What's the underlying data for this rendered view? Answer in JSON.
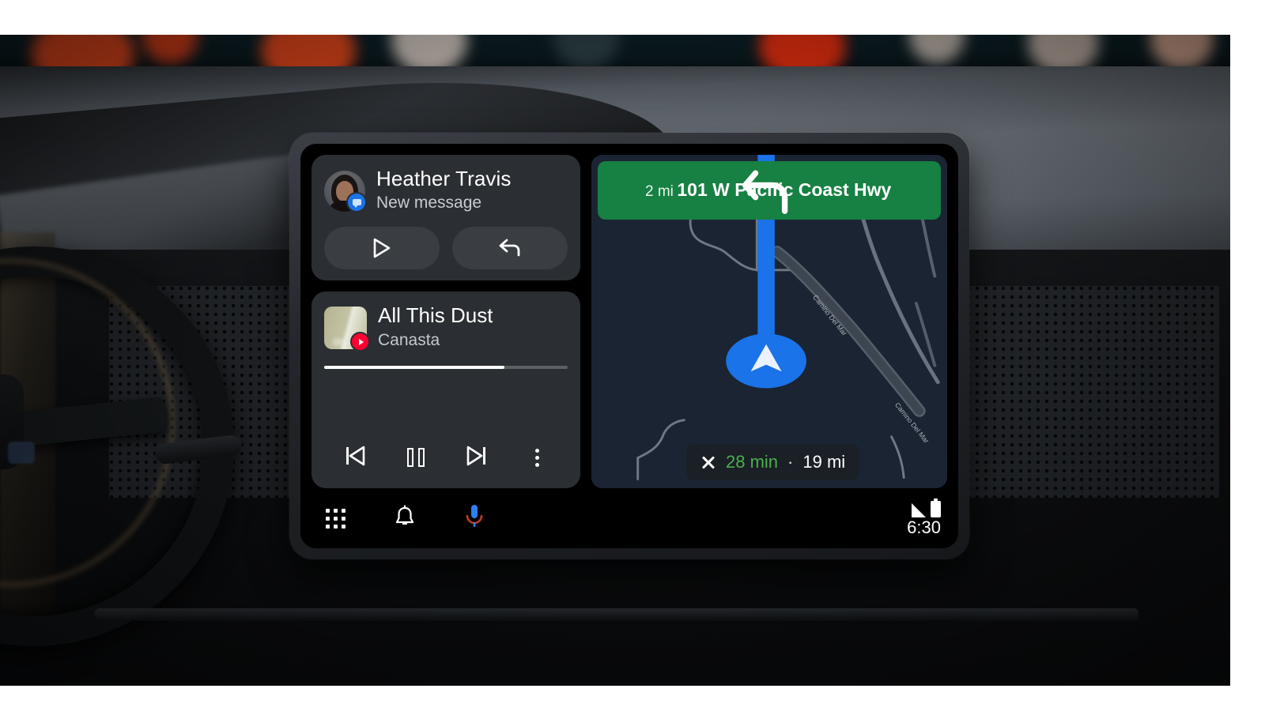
{
  "scene": {
    "description": "car-dashboard-with-head-unit",
    "bokeh_color": "#e8401a",
    "dash_color": "#6b7279"
  },
  "device": {
    "screen_bg": "#000000",
    "card_bg": "#2b2e32"
  },
  "message_card": {
    "name": "Heather Travis",
    "status": "New message",
    "avatar_name": "contact-avatar",
    "badge_app": "messages-badge",
    "actions": [
      {
        "id": "play",
        "icon": "play-icon",
        "label": "Play message"
      },
      {
        "id": "reply",
        "icon": "reply-arrow-icon",
        "label": "Reply"
      }
    ]
  },
  "media_card": {
    "title": "All This Dust",
    "artist": "Canasta",
    "album_badge": "youtube-music-badge",
    "progress_percent": 74,
    "controls": [
      {
        "id": "prev",
        "icon": "skip-previous-icon",
        "label": "Previous"
      },
      {
        "id": "pause",
        "icon": "pause-icon",
        "label": "Pause"
      },
      {
        "id": "next",
        "icon": "skip-next-icon",
        "label": "Next"
      },
      {
        "id": "overflow",
        "icon": "kebab-menu-icon",
        "label": "More options"
      }
    ]
  },
  "navigation": {
    "maneuver_icon": "turn-left-icon",
    "distance": "2 mi",
    "street": "101 W Pacific Coast Hwy",
    "banner_color": "#178043",
    "map_bg": "#1b2432",
    "route_color": "#1a73e8",
    "puck_icon": "navigation-chevron-icon",
    "road_labels": [
      "Camino Del Mar",
      "Camino Del Mar"
    ],
    "eta": {
      "close_icon": "close-icon",
      "time": "28 min",
      "separator": "·",
      "distance": "19 mi",
      "time_color": "#4caf50"
    }
  },
  "bottom_bar": {
    "buttons": [
      {
        "id": "apps",
        "icon": "app-grid-icon",
        "label": "Apps"
      },
      {
        "id": "notifications",
        "icon": "bell-icon",
        "label": "Notifications"
      },
      {
        "id": "assistant",
        "icon": "assistant-mic-icon",
        "label": "Google Assistant"
      }
    ],
    "status": {
      "signal_icon": "cell-signal-icon",
      "battery_icon": "battery-icon",
      "clock": "6:30"
    }
  }
}
